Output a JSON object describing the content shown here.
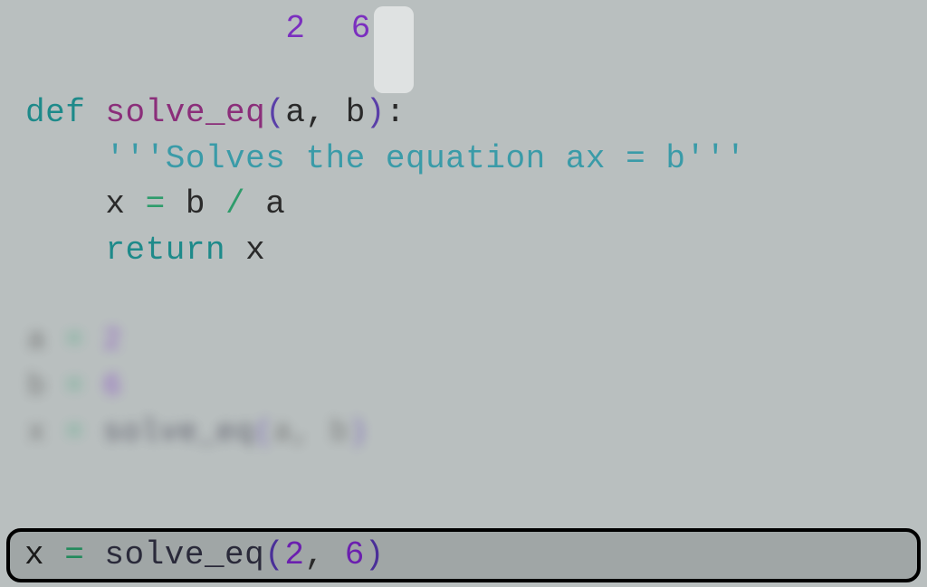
{
  "annotations": {
    "value_a": "2",
    "value_b": "6"
  },
  "code": {
    "def": "def ",
    "fn": "solve_eq",
    "lp": "(",
    "arg_a": "a",
    "comma": ", ",
    "arg_b": "b",
    "rp": ")",
    "colon": ":",
    "docstring": "    '''Solves the equation ax = b'''",
    "line_x_indent": "    ",
    "x": "x",
    "eq": " = ",
    "b": "b",
    "div": " / ",
    "a": "a",
    "return_indent": "    ",
    "return": "return ",
    "return_x": "x"
  },
  "blurred": {
    "l1_a": "a",
    "l1_eq": " = ",
    "l1_val": "2",
    "l2_b": "b",
    "l2_eq": " = ",
    "l2_val": "6",
    "l3_x": "x",
    "l3_eq": " = ",
    "l3_fn": "solve_eq",
    "l3_lp": "(",
    "l3_a": "a",
    "l3_comma": ", ",
    "l3_b": "b",
    "l3_rp": ")"
  },
  "bottom_bar": {
    "x": "x",
    "eq": " = ",
    "fn": "solve_eq",
    "lp": "(",
    "v1": "2",
    "comma": ", ",
    "v2": "6",
    "rp": ")"
  }
}
